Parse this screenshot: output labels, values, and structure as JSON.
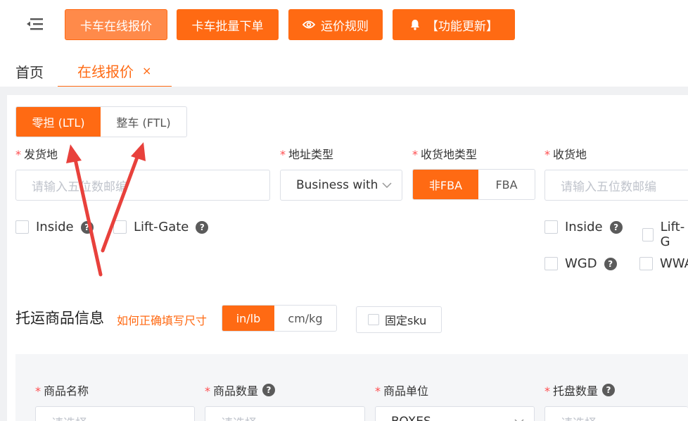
{
  "toolbar": {
    "menu_icon": "menu-fold-icon",
    "buttons": [
      {
        "label": "卡车在线报价"
      },
      {
        "label": "卡车批量下单"
      },
      {
        "label": "运价规则",
        "icon": "eye-icon"
      },
      {
        "label": "【功能更新】",
        "icon": "bell-icon"
      }
    ]
  },
  "tabs": {
    "home": "首页",
    "active": "在线报价",
    "close": "×"
  },
  "mode": {
    "options": [
      "零担 (LTL)",
      "整车 (FTL)"
    ],
    "selected": "零担 (LTL)"
  },
  "form": {
    "origin_label": "发货地",
    "origin_placeholder": "请输入五位数邮编",
    "address_type_label": "地址类型",
    "address_type_value": "Business with",
    "dest_type_label": "收货地类型",
    "dest_type_options": [
      "非FBA",
      "FBA"
    ],
    "dest_type_selected": "非FBA",
    "dest_label": "收货地",
    "dest_placeholder": "请输入五位数邮编",
    "required_mark": "*",
    "origin_options": [
      {
        "label": "Inside",
        "help": "?"
      },
      {
        "label": "Lift-Gate",
        "help": "?"
      }
    ],
    "dest_options": [
      {
        "label": "Inside",
        "help": "?"
      },
      {
        "label": "Lift-G"
      },
      {
        "label": "WGD",
        "help": "?"
      },
      {
        "label": "WWA"
      }
    ]
  },
  "goods": {
    "title": "托运商品信息",
    "howto_link": "如何正确填写尺寸",
    "unit_options": [
      "in/lb",
      "cm/kg"
    ],
    "unit_selected": "in/lb",
    "fixed_sku_label": "固定sku",
    "columns": [
      {
        "label": "商品名称",
        "placeholder": "请选择"
      },
      {
        "label": "商品数量",
        "help": "?",
        "placeholder": "请选择"
      },
      {
        "label": "商品单位",
        "value": "BOXES"
      },
      {
        "label": "托盘数量",
        "help": "?",
        "placeholder": "请选择"
      }
    ]
  },
  "colors": {
    "accent": "#ff6a13",
    "annotation": "#e8413c"
  }
}
